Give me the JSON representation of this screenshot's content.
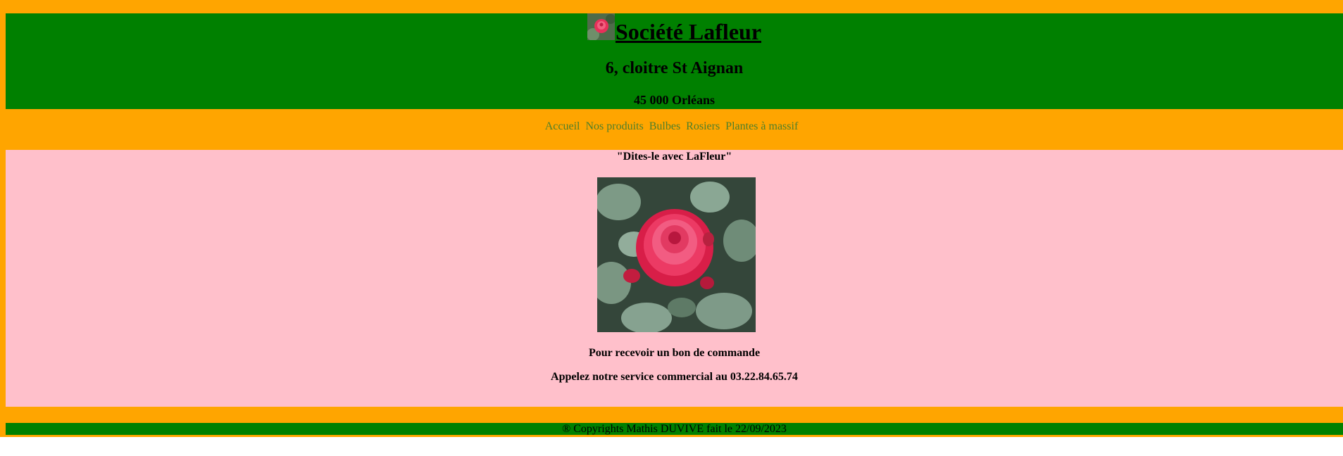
{
  "header": {
    "logo_icon": "rose-logo-icon",
    "title": "Société Lafleur",
    "address_line1": "6, cloitre St Aignan",
    "address_line2": "45 000 Orléans"
  },
  "nav": {
    "items": [
      "Accueil",
      "Nos produits",
      "Bulbes",
      "Rosiers",
      "Plantes à massif"
    ]
  },
  "content": {
    "slogan": "\"Dites-le avec LaFleur\"",
    "image_icon": "rose-photo",
    "line1": "Pour recevoir un bon de commande",
    "line2": "Appelez notre service commercial au 03.22.84.65.74"
  },
  "footer": {
    "text": "® Copyrights Mathis DUVIVE fait le 22/09/2023"
  },
  "colors": {
    "frame": "#ffa500",
    "header": "#008000",
    "content": "#ffc0cb",
    "nav_link": "#4f7f2a"
  }
}
